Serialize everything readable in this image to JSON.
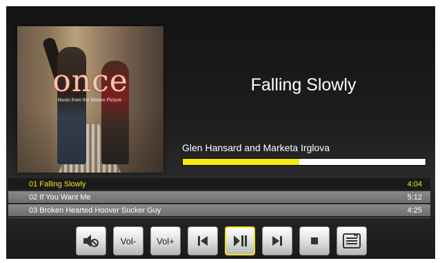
{
  "now_playing": {
    "title": "Falling Slowly",
    "artist": "Glen Hansard and Marketa Irglova",
    "progress": 0.48
  },
  "album_art": {
    "logo_text": "once",
    "subtitle": "Music from the Motion Picture"
  },
  "playlist": [
    {
      "label": "01 Falling Slowly",
      "duration": "4:04",
      "active": true
    },
    {
      "label": "02 If You Want Me",
      "duration": "5:12",
      "active": false
    },
    {
      "label": "03 Broken Hearted Hoover Sucker Guy",
      "duration": "4:25",
      "active": false
    }
  ],
  "controls": {
    "mute_icon": "mute-speaker-icon",
    "vol_down_label": "Vol-",
    "vol_up_label": "Vol+",
    "prev_icon": "skip-previous-icon",
    "play_pause_icon": "play-pause-icon",
    "next_icon": "skip-next-icon",
    "stop_icon": "stop-icon",
    "playlist_icon": "playlist-icon"
  },
  "colors": {
    "accent_yellow": "#f5ea10",
    "active_track_text": "#f5e61e"
  }
}
